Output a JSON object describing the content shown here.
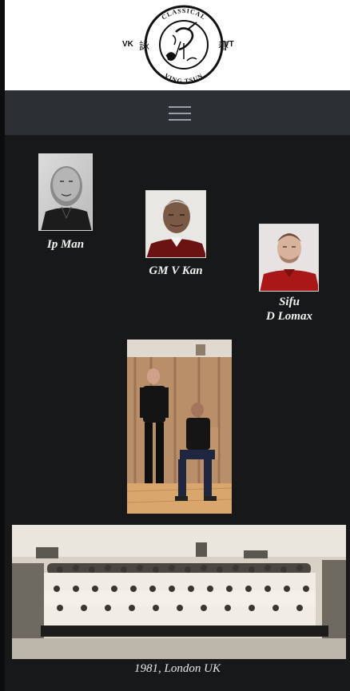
{
  "logo": {
    "top_text": "CLASSICAL",
    "bottom_text": "VING TSUN",
    "left_text": "VK",
    "right_text": "VT",
    "left_char": "詠",
    "right_char": "春"
  },
  "nav": {
    "menu_icon": "hamburger-menu-icon"
  },
  "lineage": [
    {
      "name": "Ip Man"
    },
    {
      "name": "GM V Kan"
    },
    {
      "name_line1": "Sifu",
      "name_line2": "D Lomax"
    }
  ],
  "group_photo": {
    "caption": "1981, London UK"
  },
  "colors": {
    "background": "#16181a",
    "navbar": "#2c3034",
    "header": "#ffffff",
    "caption_text": "#f2f2f2"
  }
}
